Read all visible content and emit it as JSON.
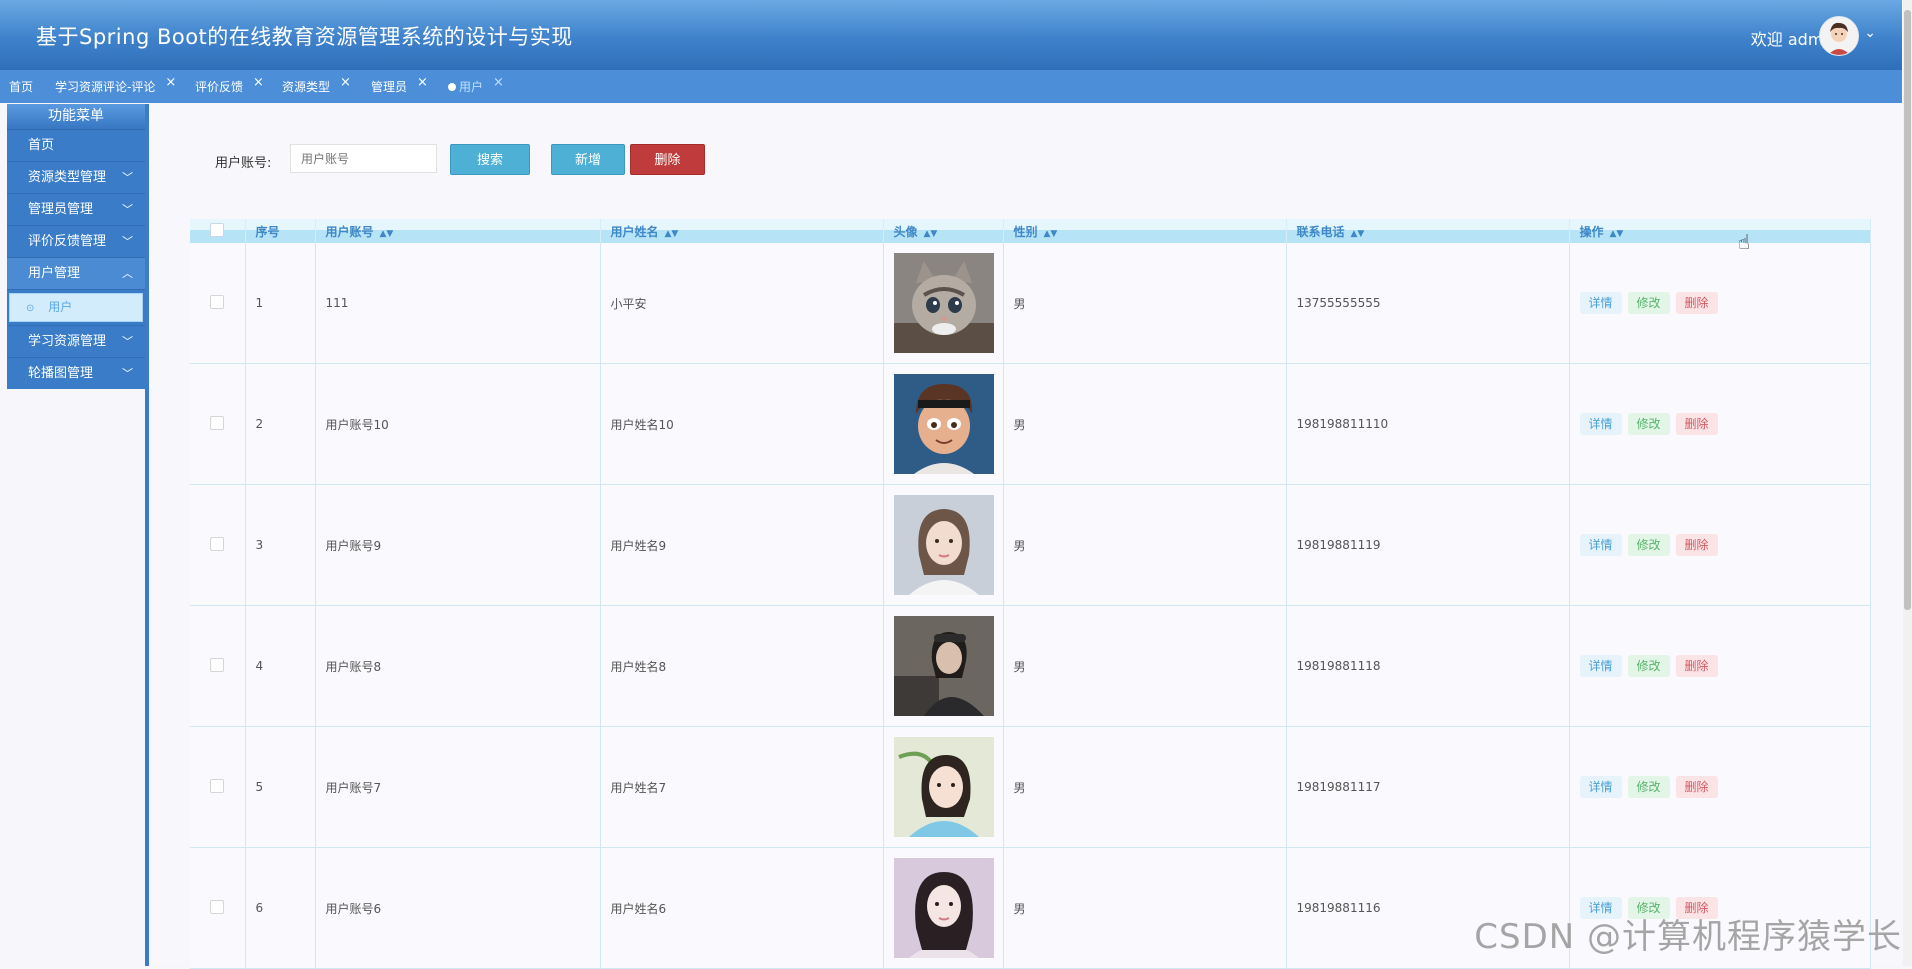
{
  "header": {
    "title": "基于Spring Boot的在线教育资源管理系统的设计与实现",
    "welcome": "欢迎 admin"
  },
  "tabs": [
    {
      "label": "首页",
      "closable": false,
      "active": false
    },
    {
      "label": "学习资源评论-评论",
      "closable": true,
      "active": false
    },
    {
      "label": "评价反馈",
      "closable": true,
      "active": false
    },
    {
      "label": "资源类型",
      "closable": true,
      "active": false
    },
    {
      "label": "管理员",
      "closable": true,
      "active": false
    },
    {
      "label": "用户",
      "closable": true,
      "active": true
    }
  ],
  "sidebar": {
    "title": "功能菜单",
    "items": [
      {
        "label": "首页"
      },
      {
        "label": "资源类型管理"
      },
      {
        "label": "管理员管理"
      },
      {
        "label": "评价反馈管理"
      },
      {
        "label": "用户管理",
        "open": true,
        "children": [
          {
            "label": "用户"
          }
        ]
      },
      {
        "label": "学习资源管理"
      },
      {
        "label": "轮播图管理"
      }
    ]
  },
  "search": {
    "label": "用户账号:",
    "placeholder": "用户账号",
    "search_button": "搜索",
    "add_button": "新增",
    "delete_button": "删除"
  },
  "table": {
    "headers": [
      "序号",
      "用户账号",
      "用户姓名",
      "头像",
      "性别",
      "联系电话",
      "操作"
    ],
    "actions": {
      "detail": "详情",
      "edit": "修改",
      "delete": "删除"
    },
    "rows": [
      {
        "index": "1",
        "account": "111",
        "name": "小平安",
        "gender": "男",
        "phone": "13755555555",
        "avatar": "kitten"
      },
      {
        "index": "2",
        "account": "用户账号10",
        "name": "用户姓名10",
        "gender": "男",
        "phone": "198198811110",
        "avatar": "cartoon-boy"
      },
      {
        "index": "3",
        "account": "用户账号9",
        "name": "用户姓名9",
        "gender": "男",
        "phone": "19819881119",
        "avatar": "girl-white-shirt"
      },
      {
        "index": "4",
        "account": "用户账号8",
        "name": "用户姓名8",
        "gender": "男",
        "phone": "19819881118",
        "avatar": "girl-dark-outfit"
      },
      {
        "index": "5",
        "account": "用户账号7",
        "name": "用户姓名7",
        "gender": "男",
        "phone": "19819881117",
        "avatar": "girl-blue-sweater"
      },
      {
        "index": "6",
        "account": "用户账号6",
        "name": "用户姓名6",
        "gender": "男",
        "phone": "19819881116",
        "avatar": "girl-pink-tone"
      }
    ]
  },
  "watermark": "CSDN @计算机程序猿学长",
  "colors": {
    "header": "#3f82cb",
    "tabbar": "#4c8ed8",
    "sidebar": "#3a7cc8",
    "search_button": "#4db0d4",
    "delete_button": "#c03b3b"
  }
}
